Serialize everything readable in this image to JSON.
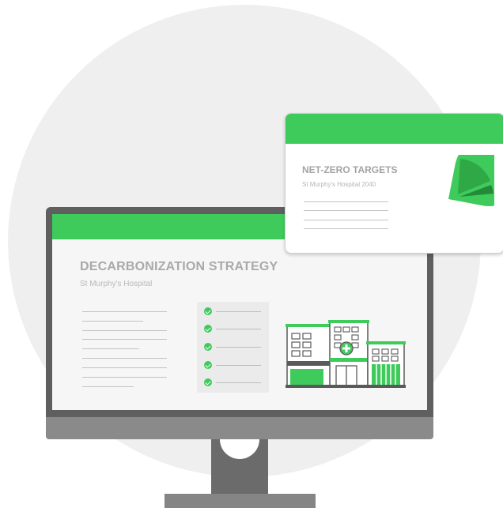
{
  "main_slide": {
    "title": "DECARBONIZATION STRATEGY",
    "subtitle": "St Murphy's Hospital",
    "checklist_items": 5
  },
  "popup_card": {
    "title": "NET-ZERO TARGETS",
    "subtitle": "St Murphy's Hospital 2040"
  },
  "icons": {
    "check": "check-circle-icon",
    "building": "hospital-building-icon",
    "pie": "pie-chart-icon"
  },
  "colors": {
    "accent_green": "#3ecb5b",
    "dark_green": "#2fa846",
    "darker_green": "#248a38",
    "monitor_gray": "#5f5f5f"
  }
}
